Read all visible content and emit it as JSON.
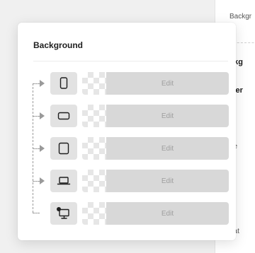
{
  "side_panel": {
    "items": [
      {
        "label": "Backgr",
        "bold": false
      },
      {
        "label": "ckg",
        "bold": true
      },
      {
        "label": "wer",
        "bold": true
      },
      {
        "label": "e",
        "bold": false
      },
      {
        "label": "ge",
        "bold": false
      },
      {
        "label": "eat",
        "bold": false
      }
    ]
  },
  "popover": {
    "title": "Background",
    "rows": [
      {
        "device": "mobile-portrait-icon",
        "edit_label": "Edit"
      },
      {
        "device": "mobile-landscape-icon",
        "edit_label": "Edit"
      },
      {
        "device": "tablet-icon",
        "edit_label": "Edit"
      },
      {
        "device": "laptop-icon",
        "edit_label": "Edit"
      },
      {
        "device": "desktop-icon",
        "edit_label": "Edit",
        "active_dot": true
      }
    ]
  },
  "colors": {
    "button_bg": "#e2e2e2",
    "edit_bg": "#d8d8d8",
    "edit_text": "#9e9e9e",
    "icon_stroke": "#1e1e1e"
  }
}
